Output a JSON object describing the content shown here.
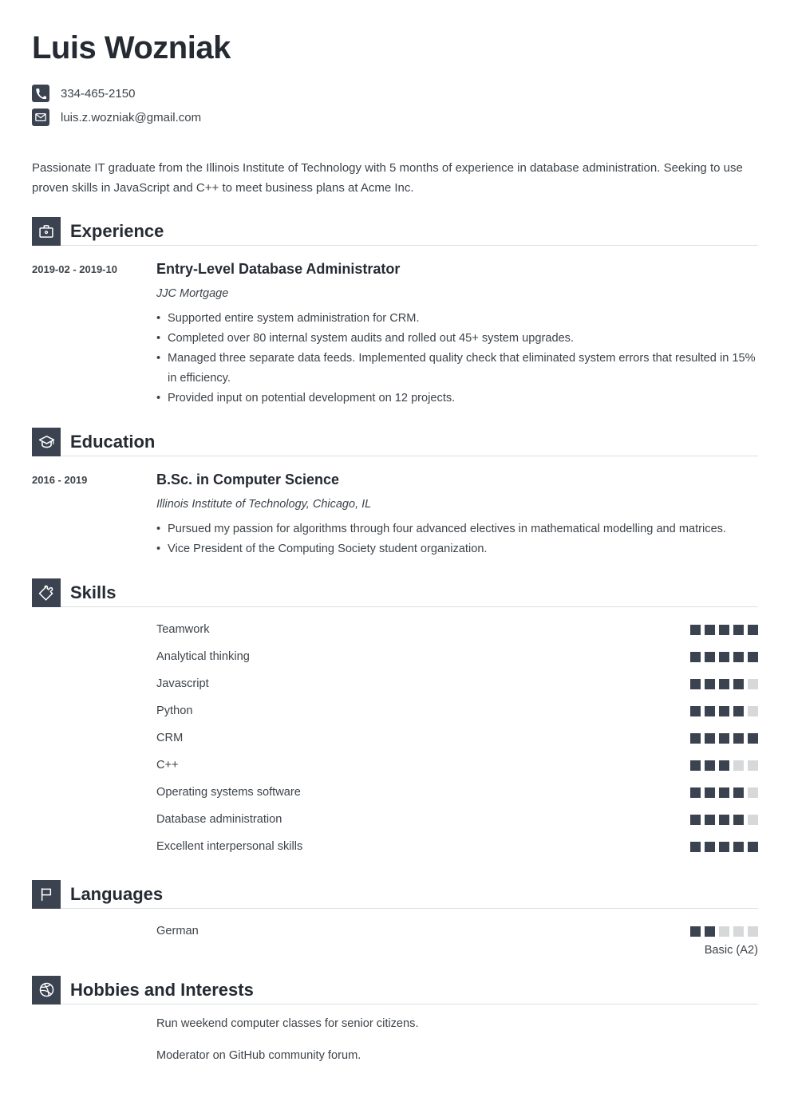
{
  "header": {
    "name": "Luis Wozniak",
    "contacts": [
      {
        "icon": "phone-icon",
        "value": "334-465-2150"
      },
      {
        "icon": "email-icon",
        "value": "luis.z.wozniak@gmail.com"
      }
    ]
  },
  "summary": "Passionate IT graduate from the Illinois Institute of Technology with 5 months of experience in database administration. Seeking to use proven skills in JavaScript and C++ to meet business plans at Acme Inc.",
  "sections": {
    "experience": {
      "title": "Experience",
      "icon": "briefcase-icon",
      "entries": [
        {
          "date": "2019-02 - 2019-10",
          "title": "Entry-Level Database Administrator",
          "subtitle": "JJC Mortgage",
          "bullets": [
            "Supported entire system administration for CRM.",
            "Completed over 80 internal system audits and rolled out 45+ system upgrades.",
            "Managed three separate data feeds. Implemented quality check that eliminated system errors that resulted in 15% in efficiency.",
            "Provided input on potential development on 12 projects."
          ]
        }
      ]
    },
    "education": {
      "title": "Education",
      "icon": "graduation-cap-icon",
      "entries": [
        {
          "date": "2016 - 2019",
          "title": "B.Sc. in Computer Science",
          "subtitle": "Illinois Institute of Technology, Chicago, IL",
          "bullets": [
            "Pursued my passion for algorithms through four advanced electives in mathematical modelling and matrices.",
            "Vice President of the Computing Society student organization."
          ]
        }
      ]
    },
    "skills": {
      "title": "Skills",
      "icon": "puzzle-piece-icon",
      "max_rating": 5,
      "items": [
        {
          "label": "Teamwork",
          "rating": 5
        },
        {
          "label": "Analytical thinking",
          "rating": 5
        },
        {
          "label": "Javascript",
          "rating": 4
        },
        {
          "label": "Python",
          "rating": 4
        },
        {
          "label": "CRM",
          "rating": 5
        },
        {
          "label": "C++",
          "rating": 3
        },
        {
          "label": "Operating systems software",
          "rating": 4
        },
        {
          "label": "Database administration",
          "rating": 4
        },
        {
          "label": "Excellent interpersonal skills",
          "rating": 5
        }
      ]
    },
    "languages": {
      "title": "Languages",
      "icon": "flag-icon",
      "max_rating": 5,
      "items": [
        {
          "label": "German",
          "rating": 2,
          "note": "Basic (A2)"
        }
      ]
    },
    "hobbies": {
      "title": "Hobbies and Interests",
      "icon": "dribbble-icon",
      "items": [
        "Run weekend computer classes for senior citizens.",
        "Moderator on GitHub community forum."
      ]
    }
  },
  "colors": {
    "accent_dark": "#3b4250",
    "heading": "#252a33",
    "body_text": "#3d4349",
    "rating_empty": "#d6d8da",
    "rule": "#dcdfe2"
  }
}
